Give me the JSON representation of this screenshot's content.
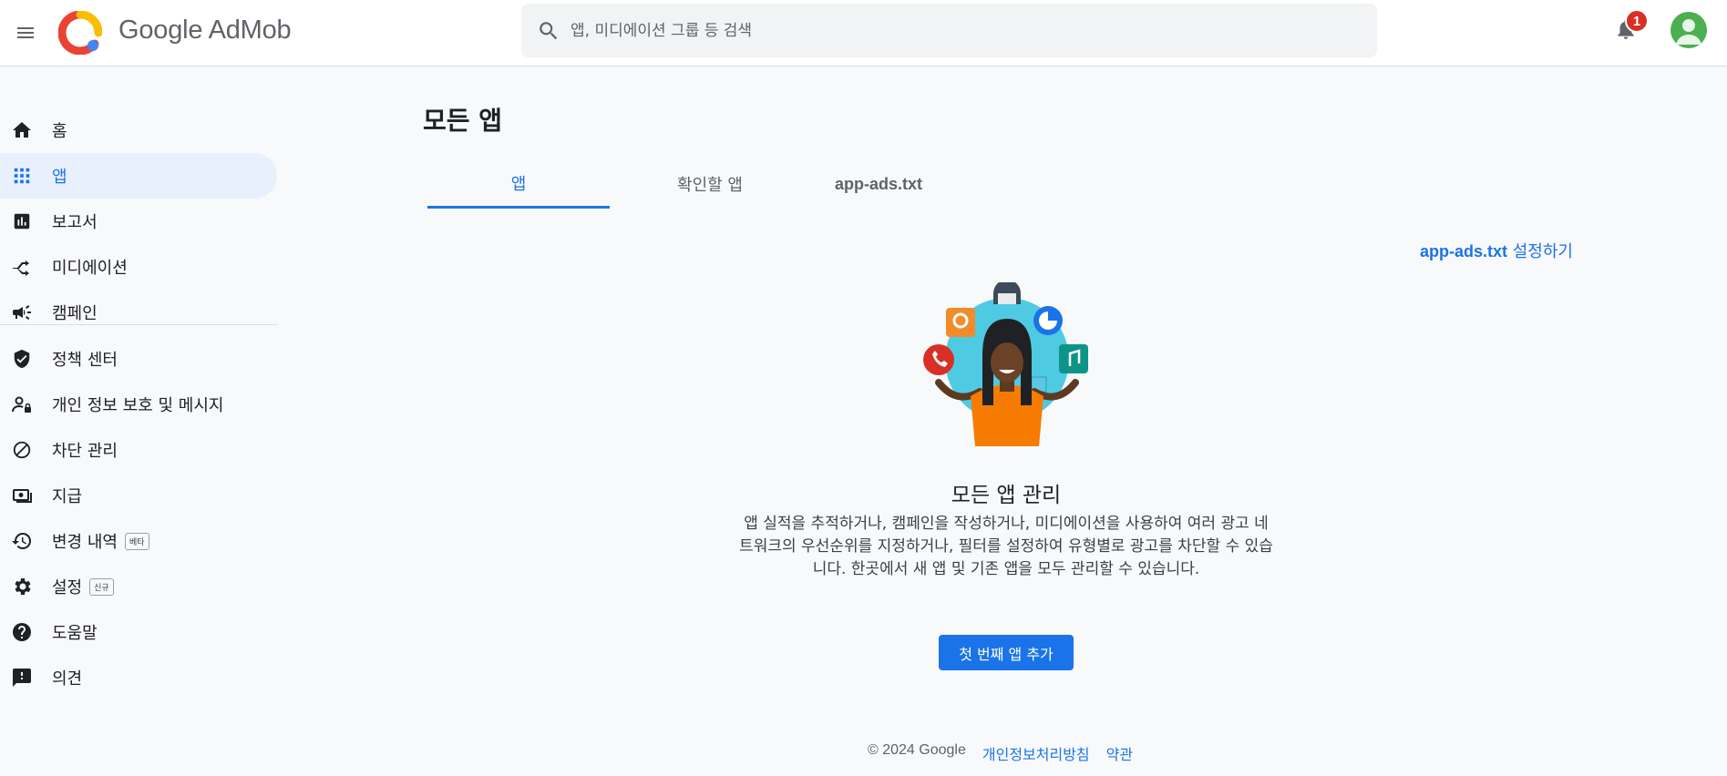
{
  "header": {
    "brand": "Google AdMob",
    "search_placeholder": "앱, 미디에이션 그룹 등 검색",
    "notification_count": "1"
  },
  "sidebar": {
    "items": [
      {
        "label": "홈",
        "icon": "home-icon"
      },
      {
        "label": "앱",
        "icon": "apps-grid-icon",
        "active": true
      },
      {
        "label": "보고서",
        "icon": "bar-chart-icon"
      },
      {
        "label": "미디에이션",
        "icon": "mediation-icon"
      },
      {
        "label": "캠페인",
        "icon": "megaphone-icon"
      },
      {
        "label": "정책 센터",
        "icon": "shield-icon"
      },
      {
        "label": "개인 정보 보호 및 메시지",
        "icon": "person-lock-icon"
      },
      {
        "label": "차단 관리",
        "icon": "block-icon"
      },
      {
        "label": "지급",
        "icon": "payments-icon"
      },
      {
        "label": "변경 내역",
        "icon": "history-icon",
        "chip": "베타"
      },
      {
        "label": "설정",
        "icon": "gear-icon",
        "chip": "신규"
      },
      {
        "label": "도움말",
        "icon": "help-icon"
      },
      {
        "label": "의견",
        "icon": "feedback-icon"
      }
    ]
  },
  "main": {
    "title": "모든 앱",
    "tabs": [
      {
        "label": "앱",
        "active": true
      },
      {
        "label": "확인할 앱"
      },
      {
        "label": "app-ads.txt"
      }
    ],
    "setup_link_bold": "app-ads.txt",
    "setup_link_text": " 설정하기",
    "empty_title": "모든 앱 관리",
    "empty_desc": "앱 실적을 추적하거나, 캠페인을 작성하거나, 미디에이션을 사용하여 여러 광고 네트워크의 우선순위를 지정하거나, 필터를 설정하여 유형별로 광고를 차단할 수 있습니다. 한곳에서 새 앱 및 기존 앱을 모두 관리할 수 있습니다.",
    "cta_label": "첫 번째 앱 추가"
  },
  "footer": {
    "copyright": "© 2024 Google",
    "privacy": "개인정보처리방침",
    "terms": "약관"
  },
  "colors": {
    "accent": "#1a73e8",
    "badge": "#d93025",
    "active_nav_bg": "#e8f0fe"
  }
}
